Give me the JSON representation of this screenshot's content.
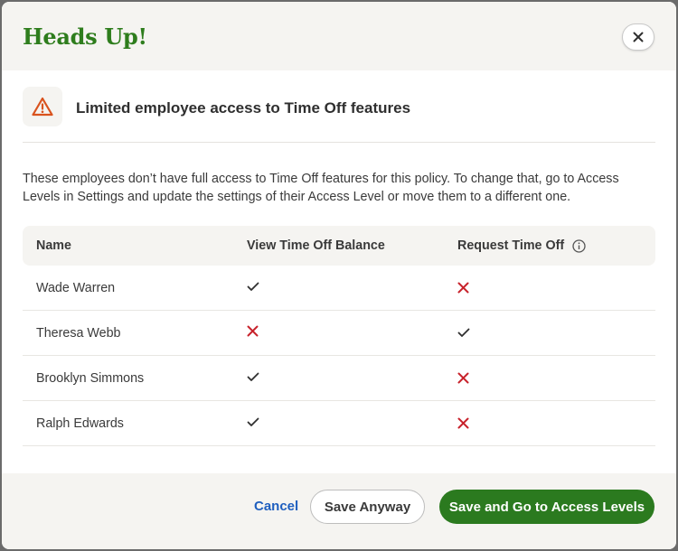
{
  "dialog": {
    "title": "Heads Up!",
    "close_icon": "close-icon"
  },
  "notice": {
    "icon": "warning-icon",
    "title": "Limited employee access to Time Off features",
    "accent_color": "#d9531e"
  },
  "description": "These employees don’t have full access to Time Off features for this policy. To change that, go to Access Levels in Settings and update the settings of their Access Level or move them to a different one.",
  "table": {
    "headers": [
      "Name",
      "View Time Off Balance",
      "Request Time Off"
    ],
    "rows": [
      {
        "name": "Wade Warren",
        "view_balance": "check",
        "request": "cross"
      },
      {
        "name": "Theresa Webb",
        "view_balance": "cross",
        "request": "check"
      },
      {
        "name": "Brooklyn Simmons",
        "view_balance": "check",
        "request": "cross"
      },
      {
        "name": "Ralph Edwards",
        "view_balance": "check",
        "request": "cross"
      }
    ]
  },
  "footer": {
    "cancel_label": "Cancel",
    "save_anyway_label": "Save Anyway",
    "save_go_label": "Save and Go to Access Levels"
  },
  "colors": {
    "brand_green": "#2e7d1d",
    "primary_button": "#2b7a1f",
    "link_blue": "#1f5fbf",
    "cross_red": "#c8232c"
  }
}
